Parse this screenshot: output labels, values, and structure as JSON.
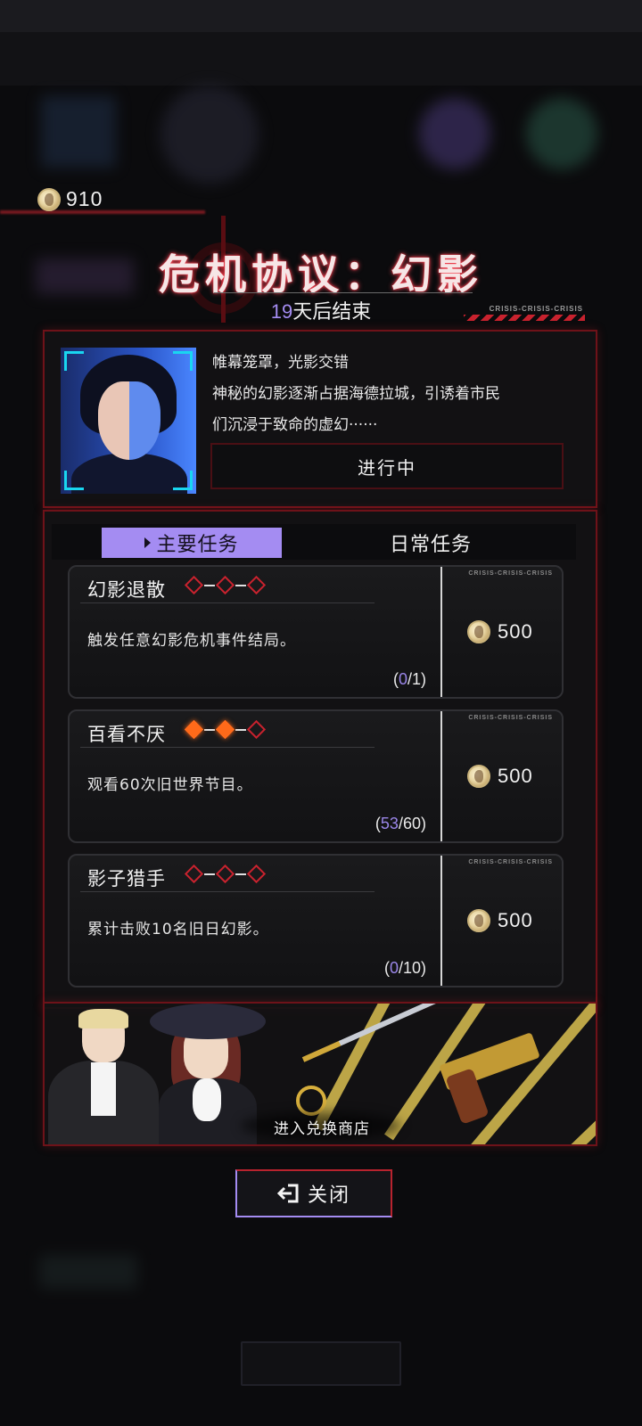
{
  "currency": {
    "icon": "coin-icon",
    "amount": "910"
  },
  "event": {
    "title": "危机协议：幻影",
    "countdown_number": "19",
    "countdown_suffix": "天后结束",
    "tag": "CRISIS-CRISIS-CRISIS"
  },
  "story": {
    "lines": [
      "帷幕笼罩，光影交错",
      "神秘的幻影逐渐占据海德拉城，引诱着市民",
      "们沉浸于致命的虚幻······"
    ],
    "status": "进行中"
  },
  "tabs": {
    "main": "主要任务",
    "daily": "日常任务"
  },
  "tasks": [
    {
      "name": "幻影退散",
      "desc": "触发任意幻影危机事件结局。",
      "progress_current": "0",
      "progress_total": "1",
      "reward": "500",
      "tag": "CRISIS-CRISIS-CRISIS",
      "difficulty_lit": 0
    },
    {
      "name": "百看不厌",
      "desc": "观看60次旧世界节目。",
      "progress_current": "53",
      "progress_total": "60",
      "reward": "500",
      "tag": "CRISIS-CRISIS-CRISIS",
      "difficulty_lit": 2
    },
    {
      "name": "影子猎手",
      "desc": "累计击败10名旧日幻影。",
      "progress_current": "0",
      "progress_total": "10",
      "reward": "500",
      "tag": "CRISIS-CRISIS-CRISIS",
      "difficulty_lit": 0
    }
  ],
  "shop": {
    "label": "进入兑换商店"
  },
  "close_button": {
    "label": "关闭",
    "icon": "exit-icon"
  },
  "colors": {
    "accent_purple": "#a48cf2",
    "accent_red": "#c8222e",
    "diamond_on": "#ff6a1a"
  }
}
